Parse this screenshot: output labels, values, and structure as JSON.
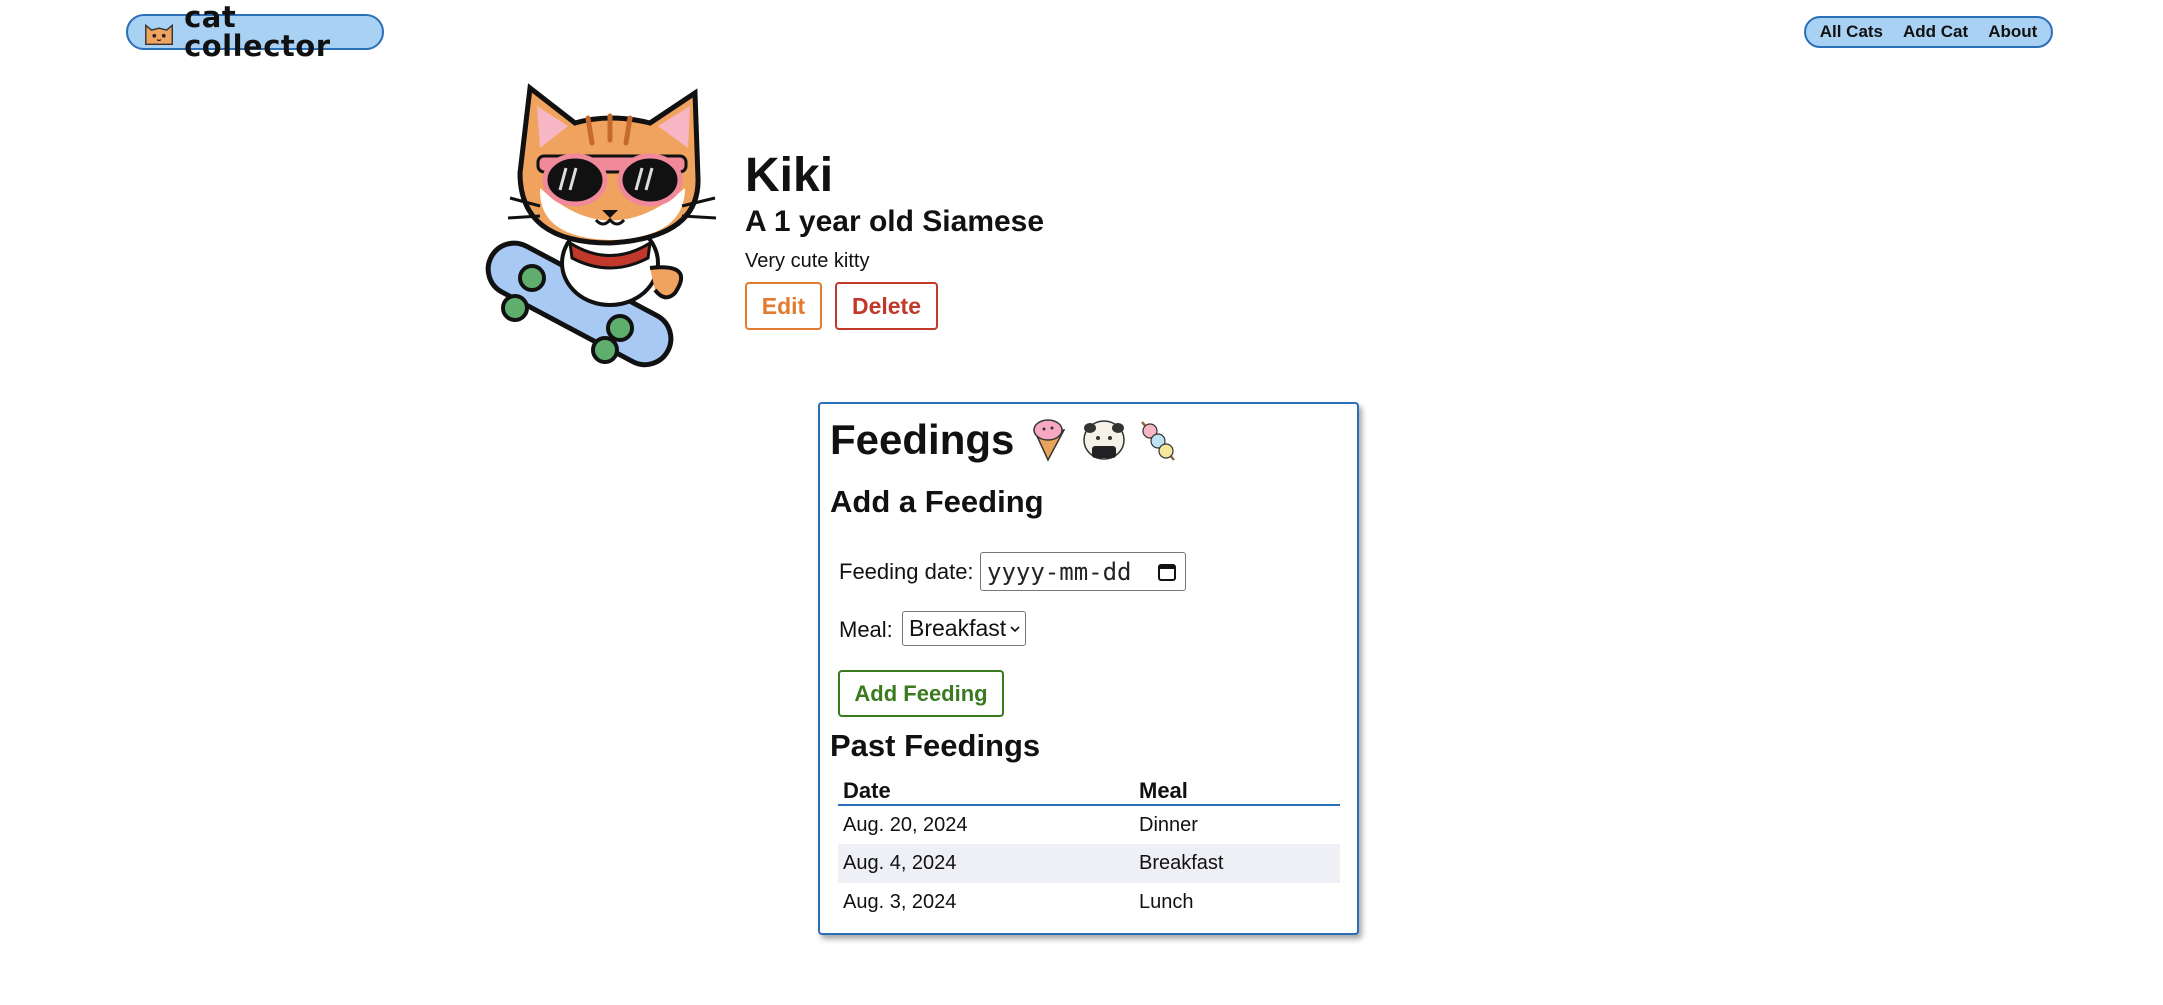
{
  "header": {
    "logo_text": "cat collector",
    "nav": [
      {
        "label": "All Cats"
      },
      {
        "label": "Add Cat"
      },
      {
        "label": "About"
      }
    ]
  },
  "cat": {
    "name": "Kiki",
    "subtitle": "A 1 year old Siamese",
    "description": "Very cute kitty",
    "edit_label": "Edit",
    "delete_label": "Delete"
  },
  "feedings": {
    "title": "Feedings",
    "add_heading": "Add a Feeding",
    "date_label": "Feeding date:",
    "date_placeholder": "yyyy-mm-dd",
    "meal_label": "Meal:",
    "meal_selected": "Breakfast",
    "add_button": "Add Feeding",
    "past_heading": "Past Feedings",
    "columns": [
      "Date",
      "Meal"
    ],
    "rows": [
      {
        "date": "Aug. 20, 2024",
        "meal": "Dinner"
      },
      {
        "date": "Aug. 4, 2024",
        "meal": "Breakfast"
      },
      {
        "date": "Aug. 3, 2024",
        "meal": "Lunch"
      }
    ]
  },
  "colors": {
    "accent_blue": "#2b6fb8",
    "nav_bg": "#a9d1f3",
    "edit": "#e27a2f",
    "delete": "#c0392b",
    "add": "#3a7a1f"
  }
}
